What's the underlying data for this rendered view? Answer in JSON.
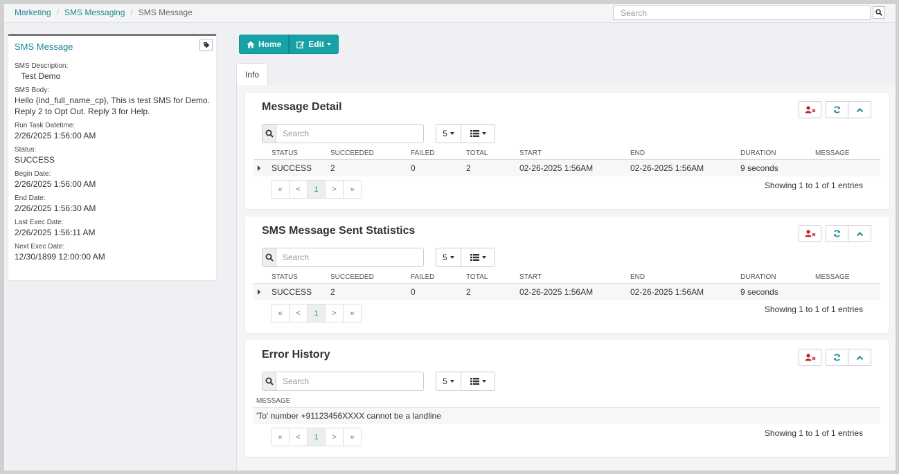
{
  "breadcrumb": {
    "items": [
      "Marketing",
      "SMS Messaging"
    ],
    "current": "SMS Message"
  },
  "top_search": {
    "placeholder": "Search"
  },
  "left_panel": {
    "title": "SMS Message",
    "fields": [
      {
        "label": "SMS Description:",
        "value": "Test Demo"
      },
      {
        "label": "SMS Body:",
        "value": "Hello {ind_full_name_cp}, This is test SMS for Demo. Reply 2 to Opt Out. Reply 3 for Help."
      },
      {
        "label": "Run Task Datetime:",
        "value": "2/26/2025 1:56:00 AM"
      },
      {
        "label": "Status:",
        "value": "SUCCESS"
      },
      {
        "label": "Begin Date:",
        "value": "2/26/2025 1:56:00 AM"
      },
      {
        "label": "End Date:",
        "value": "2/26/2025 1:56:30 AM"
      },
      {
        "label": "Last Exec Date:",
        "value": "2/26/2025 1:56:11 AM"
      },
      {
        "label": "Next Exec Date:",
        "value": "12/30/1899 12:00:00 AM"
      }
    ]
  },
  "toolbar": {
    "home_label": "Home",
    "edit_label": "Edit"
  },
  "tabs": {
    "info_label": "Info"
  },
  "table_columns": [
    "STATUS",
    "SUCCEEDED",
    "FAILED",
    "TOTAL",
    "START",
    "END",
    "DURATION",
    "MESSAGE"
  ],
  "cards": {
    "message_detail": {
      "title": "Message Detail",
      "search_placeholder": "Search",
      "page_size": "5",
      "row": {
        "status": "SUCCESS",
        "succeeded": "2",
        "failed": "0",
        "total": "2",
        "start": "02-26-2025 1:56AM",
        "end": "02-26-2025 1:56AM",
        "duration": "9 seconds",
        "message": ""
      },
      "showing": "Showing 1 to 1 of 1 entries"
    },
    "sent_stats": {
      "title": "SMS Message Sent Statistics",
      "search_placeholder": "Search",
      "page_size": "5",
      "row": {
        "status": "SUCCESS",
        "succeeded": "2",
        "failed": "0",
        "total": "2",
        "start": "02-26-2025 1:56AM",
        "end": "02-26-2025 1:56AM",
        "duration": "9 seconds",
        "message": ""
      },
      "showing": "Showing 1 to 1 of 1 entries"
    },
    "error_history": {
      "title": "Error History",
      "search_placeholder": "Search",
      "page_size": "5",
      "column": "MESSAGE",
      "row_message": "'To' number +91123456XXXX cannot be a landline",
      "showing": "Showing 1 to 1 of 1 entries"
    }
  },
  "pager": {
    "first": "«",
    "prev": "<",
    "page": "1",
    "next": ">",
    "last": "»"
  }
}
